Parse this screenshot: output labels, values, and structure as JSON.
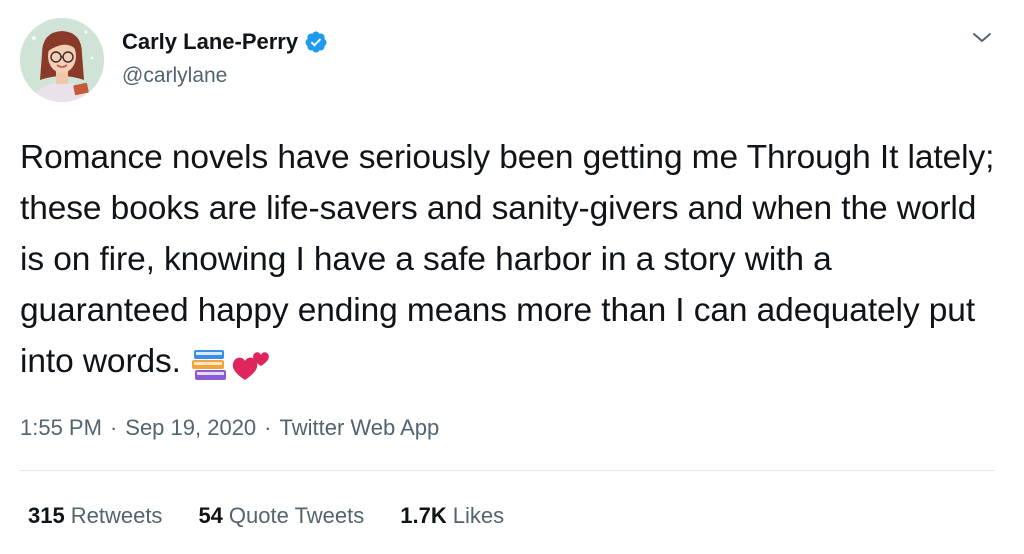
{
  "author": {
    "display_name": "Carly Lane-Perry",
    "handle": "@carlylane",
    "verified": true
  },
  "tweet": {
    "text": "Romance novels have seriously been getting me Through It lately; these books are life-savers and sanity-givers and when the world is on fire, knowing I have a safe harbor in a story with a guaranteed happy ending means more than I can adequately put into words.",
    "emojis": [
      "books-emoji",
      "two-hearts-emoji"
    ]
  },
  "meta": {
    "time": "1:55 PM",
    "separator": "·",
    "date": "Sep 19, 2020",
    "source": "Twitter Web App"
  },
  "stats": {
    "retweets_count": "315",
    "retweets_label": "Retweets",
    "quotes_count": "54",
    "quotes_label": "Quote Tweets",
    "likes_count": "1.7K",
    "likes_label": "Likes"
  },
  "colors": {
    "verified": "#1d9bf0",
    "secondary_text": "#536471",
    "primary_text": "#0f1419",
    "divider": "#e1e8ed"
  }
}
